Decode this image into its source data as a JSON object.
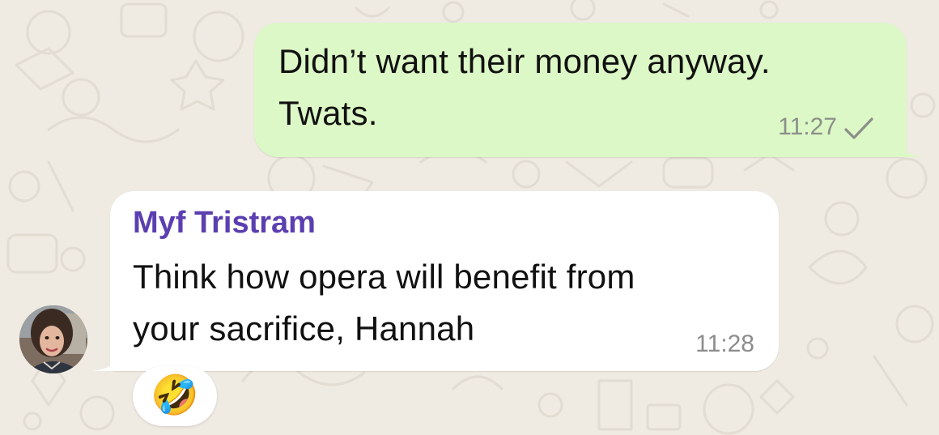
{
  "chat": {
    "messages": [
      {
        "direction": "outgoing",
        "lines": [
          "Didn’t want their money anyway.",
          "Twats."
        ],
        "time": "11:27",
        "status_icon": "single-check-icon"
      },
      {
        "direction": "incoming",
        "sender": "Myf Tristram",
        "lines": [
          "Think how opera will benefit from",
          "your sacrifice, Hannah"
        ],
        "time": "11:28",
        "reaction": "🤣"
      }
    ]
  },
  "colors": {
    "background": "#efeae2",
    "outgoing_bubble": "#dcf8c6",
    "incoming_bubble": "#ffffff",
    "sender_name": "#5b3fb0",
    "timestamp": "#8a8f89"
  }
}
